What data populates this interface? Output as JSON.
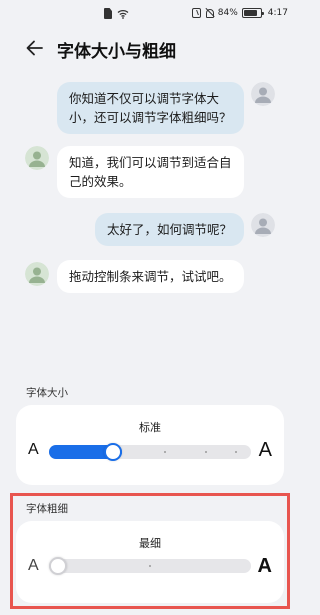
{
  "status_bar": {
    "battery": "84%",
    "time": "4:17",
    "battery_level": 0.84,
    "icons": [
      "sim-icon",
      "wifi-icon",
      "nfc-icon",
      "mute-icon",
      "battery-icon"
    ]
  },
  "header": {
    "title": "字体大小与粗细",
    "back_icon": "back-arrow-icon"
  },
  "chat": {
    "messages": [
      {
        "from": "me",
        "text_lines": [
          "你知道不仅可以调节字体大",
          "小，还可以调节字体粗细吗？"
        ]
      },
      {
        "from": "other",
        "text_lines": [
          "知道，我们可以调节到适合自",
          "己的效果。"
        ]
      },
      {
        "from": "me",
        "text_lines": [
          "太好了，如何调节呢？"
        ]
      },
      {
        "from": "other",
        "text_lines": [
          "拖动控制条来调节，试试吧。"
        ]
      }
    ]
  },
  "font_size": {
    "label": "字体大小",
    "value": "标准",
    "small_glyph": "A",
    "large_glyph": "A",
    "level": 0.3
  },
  "font_weight": {
    "label": "字体粗细",
    "value": "最细",
    "small_glyph": "A",
    "large_glyph": "A",
    "level": 0
  },
  "colors": {
    "accent": "#1a6ee8",
    "highlight": "#e8554f",
    "bubble_me": "#d9e7f1",
    "background": "#f1f2f5"
  }
}
